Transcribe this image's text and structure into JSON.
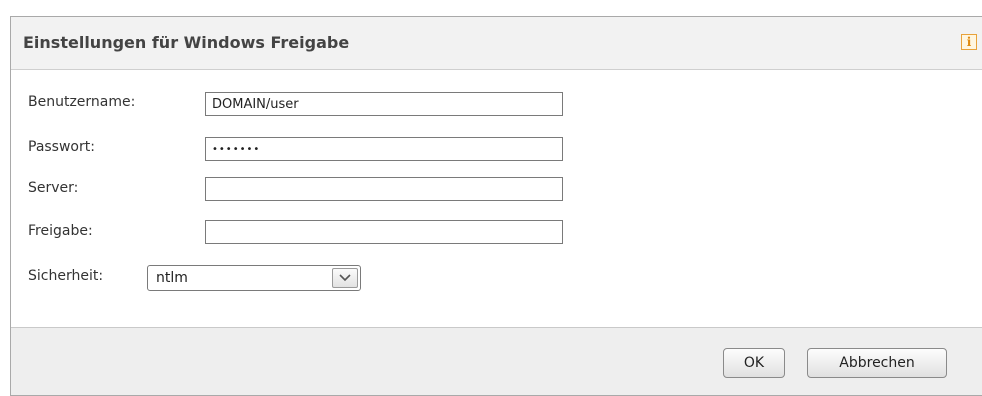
{
  "dialog": {
    "title": "Einstellungen für Windows Freigabe",
    "info_icon": "info-icon"
  },
  "form": {
    "username": {
      "label": "Benutzername:",
      "value": "DOMAIN/user"
    },
    "password": {
      "label": "Passwort:",
      "value": "•••••••"
    },
    "server": {
      "label": "Server:",
      "value": ""
    },
    "share": {
      "label": "Freigabe:",
      "value": ""
    },
    "security": {
      "label": "Sicherheit:",
      "selected": "ntlm",
      "icon": "chevron-down-icon"
    }
  },
  "buttons": {
    "ok_label": "OK",
    "cancel_label": "Abbrechen"
  },
  "colors": {
    "header_bg": "#f2f2f2",
    "footer_bg": "#eeeeee",
    "border": "#a9a9a9",
    "info_accent": "#e8a23a"
  }
}
